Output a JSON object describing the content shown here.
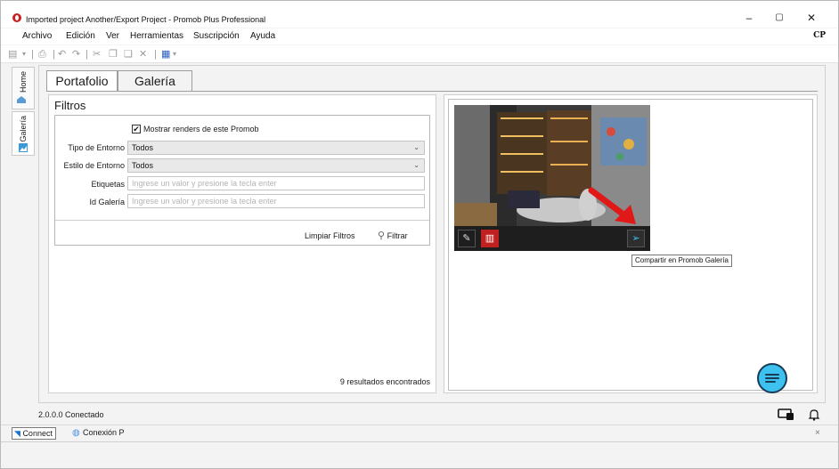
{
  "window": {
    "title": "Imported project Another/Export Project - Promob Plus Professional",
    "minimize": "–",
    "restore": "▢",
    "close": "✕"
  },
  "menu": {
    "items": [
      "Archivo",
      "Edición",
      "Ver",
      "Herramientas",
      "Suscripción",
      "Ayuda"
    ],
    "user_badge": "CP"
  },
  "side_tabs": {
    "home": "Home",
    "gallery": "Galería"
  },
  "tabs": [
    {
      "label": "Portafolio",
      "active": true
    },
    {
      "label": "Galería",
      "active": false
    }
  ],
  "filters": {
    "title": "Filtros",
    "show_renders_label": "Mostrar renders de este Promob",
    "show_renders_checked": true,
    "environment_type": {
      "label": "Tipo de Entorno",
      "value": "Todos"
    },
    "environment_style": {
      "label": "Estilo de Entorno",
      "value": "Todos"
    },
    "tags": {
      "label": "Etiquetas",
      "placeholder": "Ingrese un valor y presione la tecla enter"
    },
    "gallery_id": {
      "label": "Id Galería",
      "placeholder": "Ingrese un valor y presione la tecla enter"
    },
    "clear_label": "Limpiar Filtros",
    "filter_label": "Filtrar",
    "results": "9 resultados encontrados"
  },
  "gallery": {
    "share_tooltip": "Compartir en Promob Galería",
    "card_actions": [
      "edit-icon",
      "delete-icon",
      "share-icon"
    ]
  },
  "status": {
    "text": "2.0.0.0 Conectado"
  },
  "connect": {
    "button": "Connect",
    "connection": "Conexión P",
    "close": "×"
  },
  "colors": {
    "accent": "#3dc1ee",
    "delete": "#c0201f",
    "arrow": "#e01818"
  }
}
